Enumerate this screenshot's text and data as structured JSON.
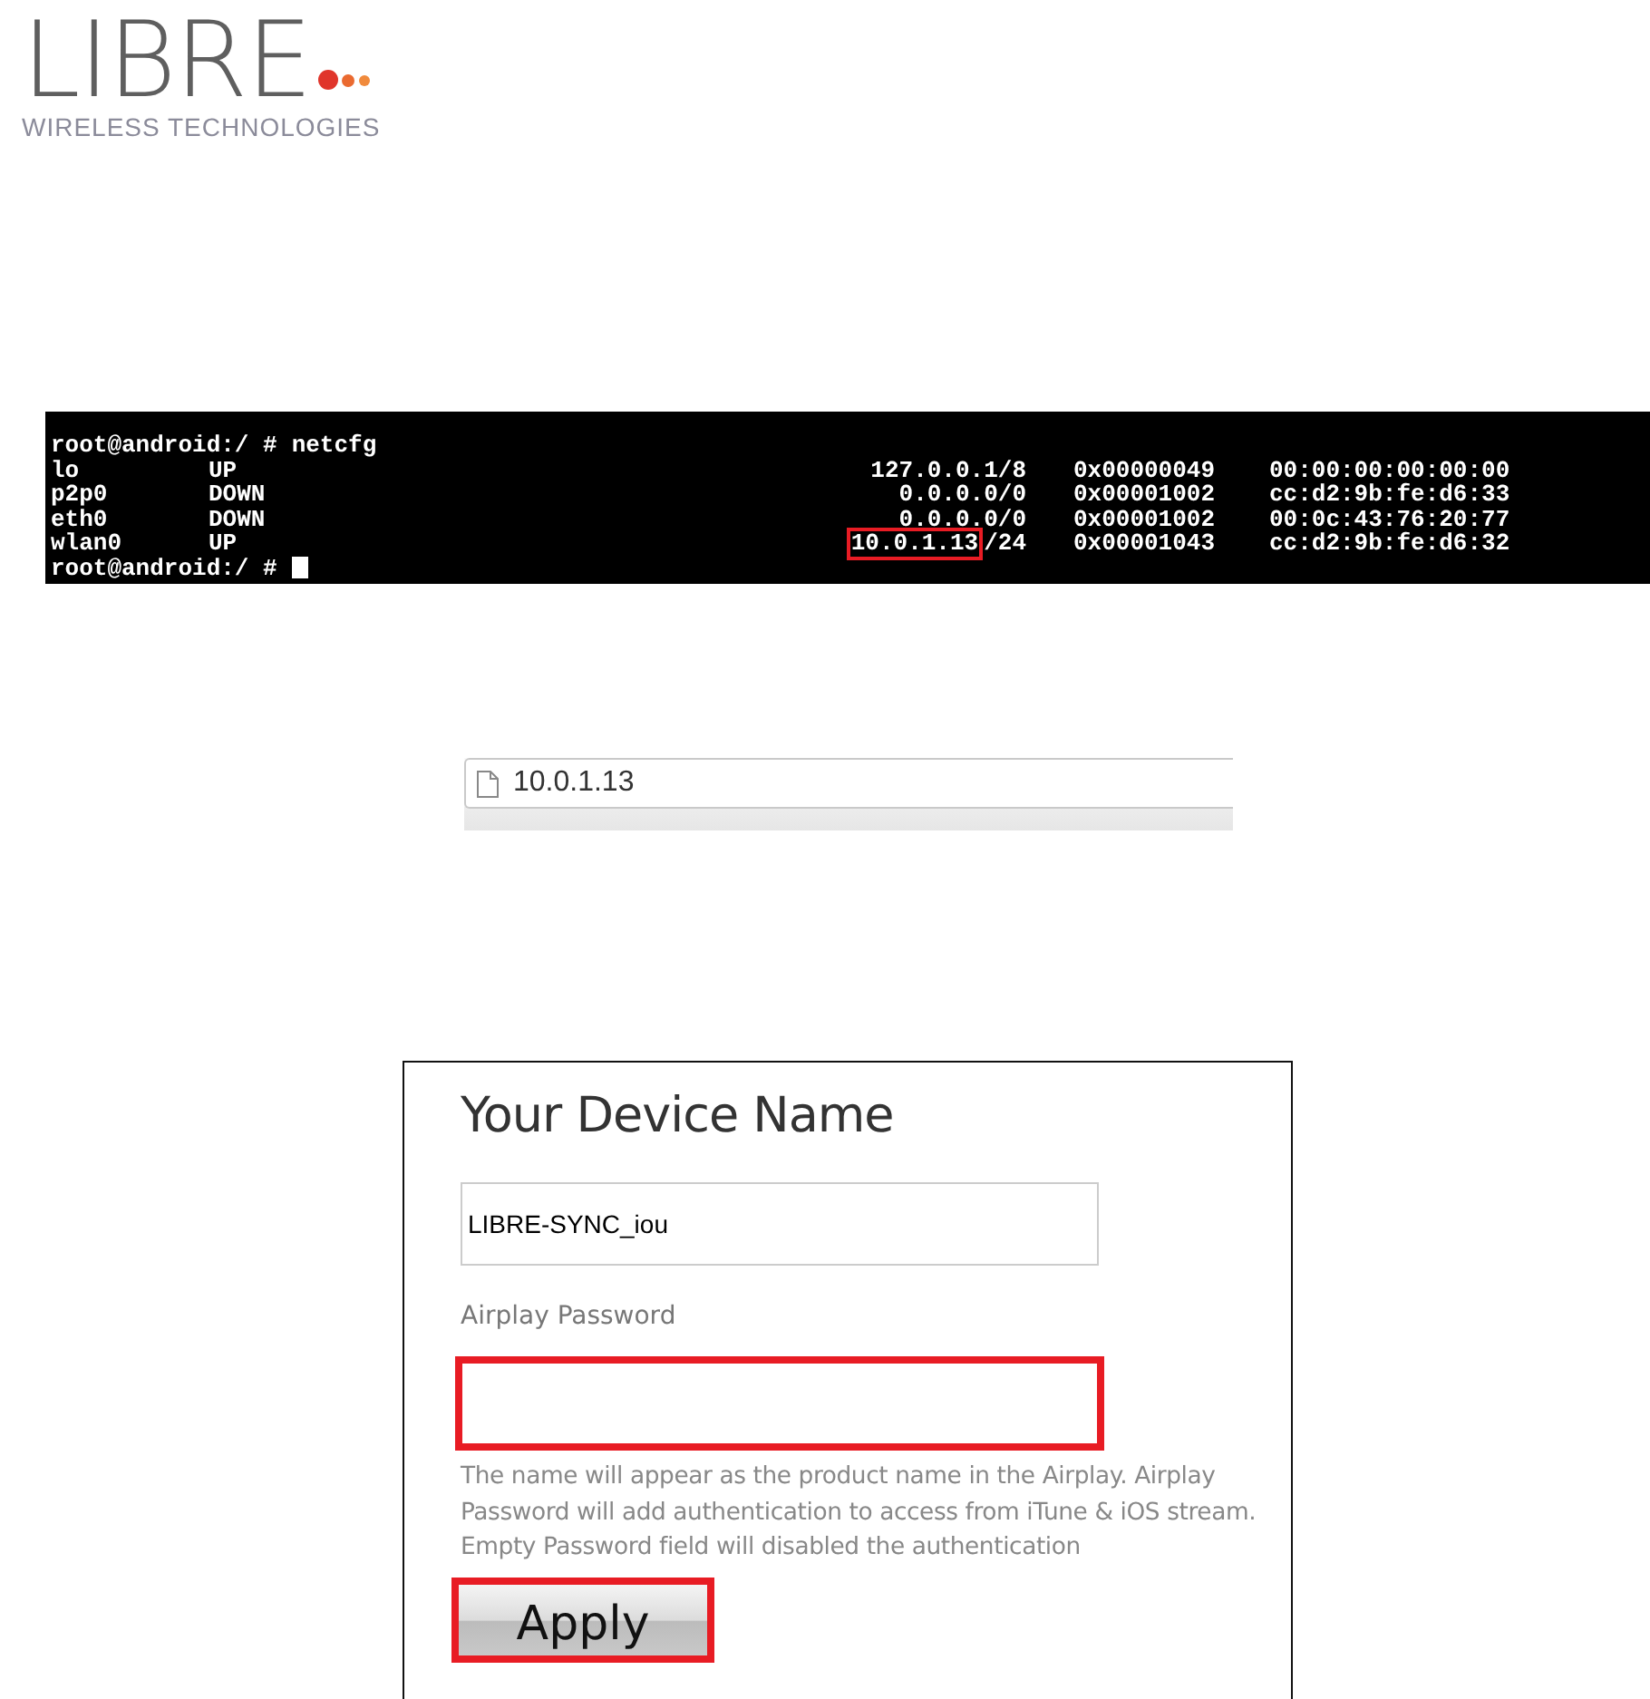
{
  "logo": {
    "name": "LIBRE",
    "tagline": "WIRELESS TECHNOLOGIES"
  },
  "terminal": {
    "command_line": {
      "prompt": "root@android:/ #",
      "command": "netcfg"
    },
    "rows": [
      {
        "interface": "lo",
        "state": "UP",
        "ip": "127.0.0.1",
        "prefix": "/8",
        "flags": "0x00000049",
        "mac": "00:00:00:00:00:00",
        "highlighted": false
      },
      {
        "interface": "p2p0",
        "state": "DOWN",
        "ip": "0.0.0.0",
        "prefix": "/0",
        "flags": "0x00001002",
        "mac": "cc:d2:9b:fe:d6:33",
        "highlighted": false
      },
      {
        "interface": "eth0",
        "state": "DOWN",
        "ip": "0.0.0.0",
        "prefix": "/0",
        "flags": "0x00001002",
        "mac": "00:0c:43:76:20:77",
        "highlighted": false
      },
      {
        "interface": "wlan0",
        "state": "UP",
        "ip": "10.0.1.13",
        "prefix": "/24",
        "flags": "0x00001043",
        "mac": "cc:d2:9b:fe:d6:32",
        "highlighted": true
      }
    ],
    "final_prompt": "root@android:/ #"
  },
  "address_bar": {
    "url": "10.0.1.13"
  },
  "device_form": {
    "title": "Your Device Name",
    "name_field": {
      "value": "LIBRE-SYNC_iou",
      "highlighted": false
    },
    "password_label": "Airplay Password",
    "password_field": {
      "highlighted": true
    },
    "help_text": "The name will appear as the product name in the Airplay. Airplay Password will add authentication to access from iTune & iOS stream. Empty Password field will disabled the authentication",
    "apply_button": {
      "label": "Apply",
      "highlighted": true
    }
  }
}
